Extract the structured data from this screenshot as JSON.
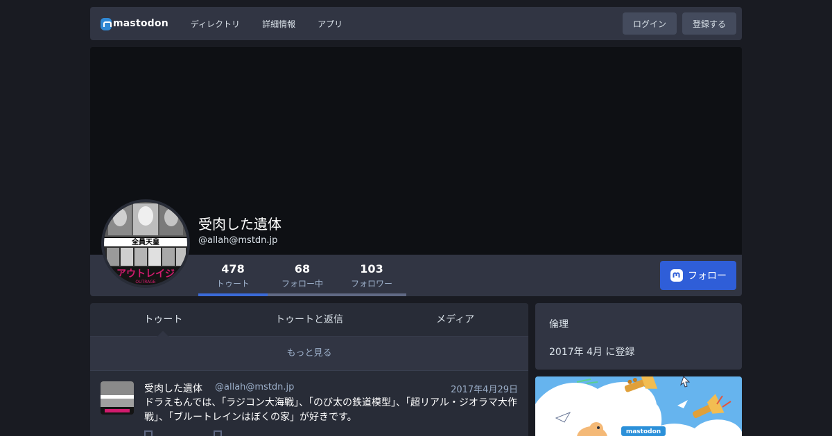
{
  "nav": {
    "logo": "mastodon",
    "links": [
      "ディレクトリ",
      "詳細情報",
      "アプリ"
    ],
    "login": "ログイン",
    "register": "登録する"
  },
  "profile": {
    "display_name": "受肉した遺体",
    "acct": "@allah@mstdn.jp",
    "avatar_text": "全員天皇",
    "avatar_title": "アウトレイジ",
    "avatar_sub": "OUTRAGE",
    "counters": [
      {
        "num": "478",
        "label": "トゥート"
      },
      {
        "num": "68",
        "label": "フォロー中"
      },
      {
        "num": "103",
        "label": "フォロワー"
      }
    ],
    "follow": "フォロー"
  },
  "tabs": [
    "トゥート",
    "トゥートと返信",
    "メディア"
  ],
  "load_more": "もっと見る",
  "status": {
    "name": "受肉した遺体",
    "acct": "@allah@mstdn.jp",
    "time": "2017年4月29日",
    "text": "ドラえもんでは、「ラジコン大海戦」、「のび太の鉄道模型」、「超リアル・ジオラマ大作戦」、「ブルートレインはぼくの家」が好きです。"
  },
  "side": {
    "note": "倫理",
    "joined": "2017年 4月 に登録",
    "art_logo": "mastodon"
  },
  "colors": {
    "background": "#191b22",
    "bar": "#313543",
    "accent": "#2f5ed8",
    "art": "#66b4ee"
  }
}
